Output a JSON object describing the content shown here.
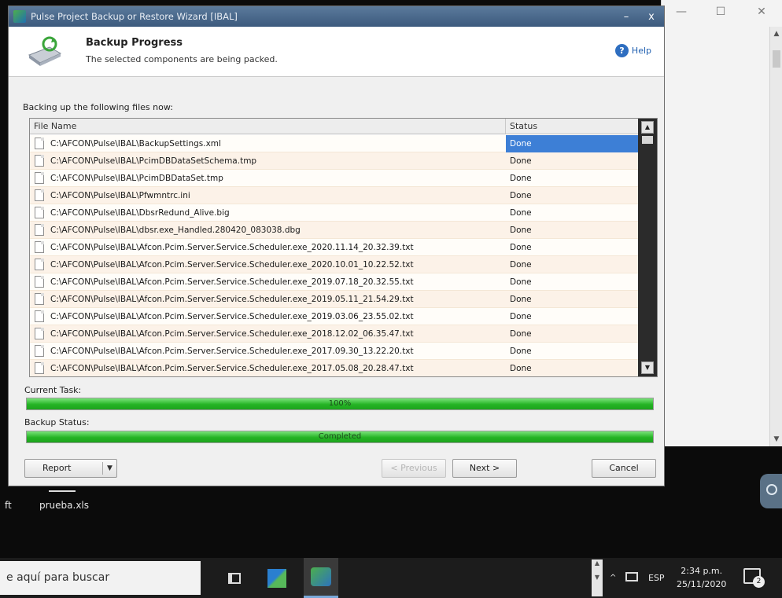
{
  "dialog": {
    "title": "Pulse Project Backup or Restore Wizard [IBAL]",
    "title_buttons": {
      "minimize": "–",
      "close": "x"
    },
    "header": {
      "title": "Backup Progress",
      "subtitle": "The selected components are being packed.",
      "help": "Help"
    },
    "files_label": "Backing up the following files now:",
    "columns": {
      "name": "File Name",
      "status": "Status"
    },
    "files": [
      {
        "name": "C:\\AFCON\\Pulse\\IBAL\\BackupSettings.xml",
        "status": "Done",
        "selected": true
      },
      {
        "name": "C:\\AFCON\\Pulse\\IBAL\\PcimDBDataSetSchema.tmp",
        "status": "Done"
      },
      {
        "name": "C:\\AFCON\\Pulse\\IBAL\\PcimDBDataSet.tmp",
        "status": "Done"
      },
      {
        "name": "C:\\AFCON\\Pulse\\IBAL\\Pfwmntrc.ini",
        "status": "Done"
      },
      {
        "name": "C:\\AFCON\\Pulse\\IBAL\\DbsrRedund_Alive.big",
        "status": "Done"
      },
      {
        "name": "C:\\AFCON\\Pulse\\IBAL\\dbsr.exe_Handled.280420_083038.dbg",
        "status": "Done"
      },
      {
        "name": "C:\\AFCON\\Pulse\\IBAL\\Afcon.Pcim.Server.Service.Scheduler.exe_2020.11.14_20.32.39.txt",
        "status": "Done"
      },
      {
        "name": "C:\\AFCON\\Pulse\\IBAL\\Afcon.Pcim.Server.Service.Scheduler.exe_2020.10.01_10.22.52.txt",
        "status": "Done"
      },
      {
        "name": "C:\\AFCON\\Pulse\\IBAL\\Afcon.Pcim.Server.Service.Scheduler.exe_2019.07.18_20.32.55.txt",
        "status": "Done"
      },
      {
        "name": "C:\\AFCON\\Pulse\\IBAL\\Afcon.Pcim.Server.Service.Scheduler.exe_2019.05.11_21.54.29.txt",
        "status": "Done"
      },
      {
        "name": "C:\\AFCON\\Pulse\\IBAL\\Afcon.Pcim.Server.Service.Scheduler.exe_2019.03.06_23.55.02.txt",
        "status": "Done"
      },
      {
        "name": "C:\\AFCON\\Pulse\\IBAL\\Afcon.Pcim.Server.Service.Scheduler.exe_2018.12.02_06.35.47.txt",
        "status": "Done"
      },
      {
        "name": "C:\\AFCON\\Pulse\\IBAL\\Afcon.Pcim.Server.Service.Scheduler.exe_2017.09.30_13.22.20.txt",
        "status": "Done"
      },
      {
        "name": "C:\\AFCON\\Pulse\\IBAL\\Afcon.Pcim.Server.Service.Scheduler.exe_2017.05.08_20.28.47.txt",
        "status": "Done"
      }
    ],
    "current_task": {
      "label": "Current Task:",
      "text": "100%",
      "progress": 1.0
    },
    "backup_status": {
      "label": "Backup Status:",
      "text": "Completed",
      "progress": 1.0
    },
    "buttons": {
      "report": "Report",
      "previous": "< Previous",
      "next": "Next >",
      "cancel": "Cancel"
    }
  },
  "background_window": {
    "minimize": "—",
    "maximize": "☐",
    "close": "✕"
  },
  "desktop": {
    "file_label": "prueba.xls",
    "left_fragment": "ft"
  },
  "taskbar": {
    "search_placeholder": "e aquí para buscar",
    "lang": "ESP",
    "time": "2:34 p.m.",
    "date": "25/11/2020",
    "notification_count": "2"
  },
  "colors": {
    "progress_green": "#25b425",
    "selection_blue": "#3d7fd6",
    "titlebar": "#3c5a7d"
  }
}
